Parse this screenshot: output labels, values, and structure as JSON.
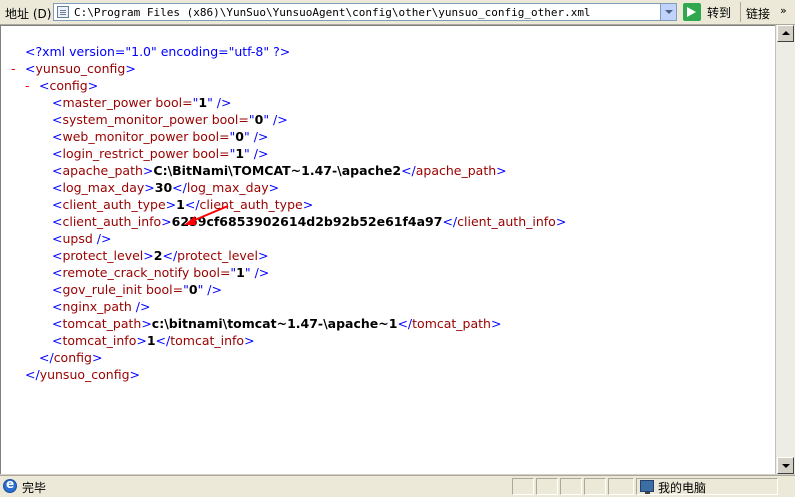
{
  "address_bar": {
    "label": "地址 (D)",
    "url": "C:\\Program Files (x86)\\YunSuo\\YunsuoAgent\\config\\other\\yunsuo_config_other.xml",
    "go_label": "转到",
    "links_label": "链接",
    "links_chevron": "»"
  },
  "xml": {
    "declaration": "<?xml version=\"1.0\" encoding=\"utf-8\" ?>",
    "root_open": "yunsuo_config",
    "config_open": "config",
    "items": [
      {
        "kind": "attr",
        "tag": "master_power",
        "attr": "bool",
        "value": "1"
      },
      {
        "kind": "attr",
        "tag": "system_monitor_power",
        "attr": "bool",
        "value": "0"
      },
      {
        "kind": "attr",
        "tag": "web_monitor_power",
        "attr": "bool",
        "value": "0"
      },
      {
        "kind": "attr",
        "tag": "login_restrict_power",
        "attr": "bool",
        "value": "1"
      },
      {
        "kind": "text",
        "tag": "apache_path",
        "value": "C:\\BitNami\\TOMCAT~1.47-\\apache2"
      },
      {
        "kind": "text",
        "tag": "log_max_day",
        "value": "30"
      },
      {
        "kind": "text",
        "tag": "client_auth_type",
        "value": "1"
      },
      {
        "kind": "text",
        "tag": "client_auth_info",
        "value": "6259cf6853902614d2b92b52e61f4a97"
      },
      {
        "kind": "empty",
        "tag": "upsd"
      },
      {
        "kind": "text",
        "tag": "protect_level",
        "value": "2"
      },
      {
        "kind": "attr",
        "tag": "remote_crack_notify",
        "attr": "bool",
        "value": "1"
      },
      {
        "kind": "attr",
        "tag": "gov_rule_init",
        "attr": "bool",
        "value": "0"
      },
      {
        "kind": "empty",
        "tag": "nginx_path"
      },
      {
        "kind": "text",
        "tag": "tomcat_path",
        "value": "c:\\bitnami\\tomcat~1.47-\\apache~1"
      },
      {
        "kind": "text",
        "tag": "tomcat_info",
        "value": "1"
      }
    ],
    "config_close": "config",
    "root_close": "yunsuo_config"
  },
  "status_bar": {
    "status_text": "完毕",
    "zone_text": "我的电脑"
  },
  "annotation": {
    "arrow_color": "#ff0000"
  }
}
